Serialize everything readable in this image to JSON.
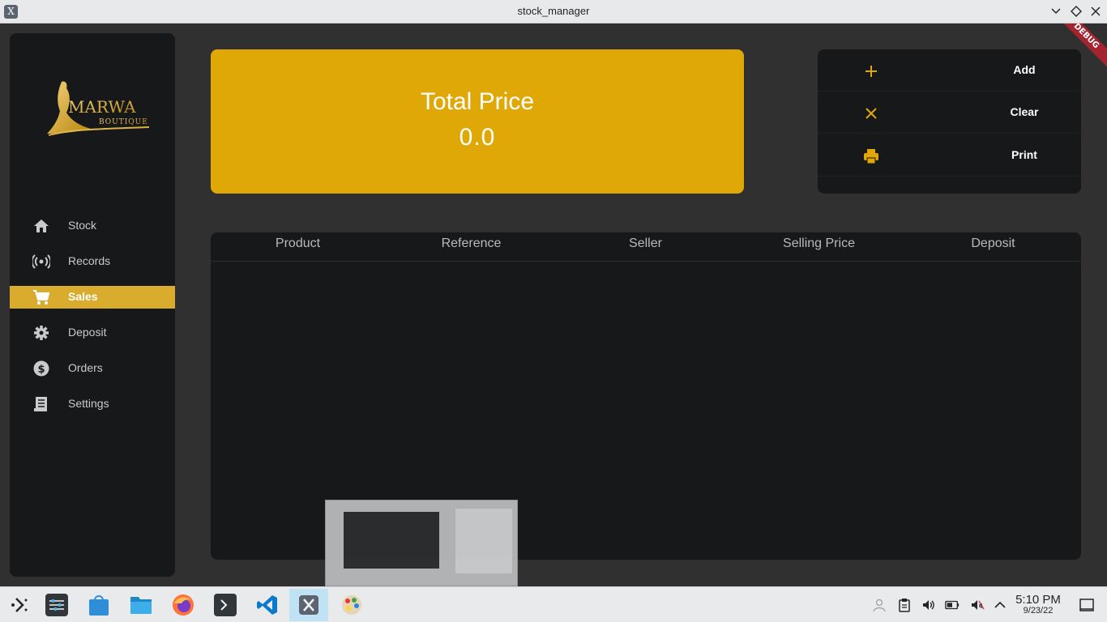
{
  "window": {
    "title": "stock_manager"
  },
  "debug_banner": "DEBUG",
  "logo": {
    "name": "MARWA",
    "tagline": "BOUTIQUE"
  },
  "sidebar": {
    "items": [
      {
        "label": "Stock",
        "icon": "home-icon",
        "active": false
      },
      {
        "label": "Records",
        "icon": "broadcast-icon",
        "active": false
      },
      {
        "label": "Sales",
        "icon": "cart-icon",
        "active": true
      },
      {
        "label": "Deposit",
        "icon": "gear-icon",
        "active": false
      },
      {
        "label": "Orders",
        "icon": "dollar-icon",
        "active": false
      },
      {
        "label": "Settings",
        "icon": "receipt-icon",
        "active": false
      }
    ]
  },
  "total": {
    "label": "Total Price",
    "value": "0.0"
  },
  "actions": [
    {
      "label": "Add",
      "icon": "plus-icon"
    },
    {
      "label": "Clear",
      "icon": "close-icon"
    },
    {
      "label": "Print",
      "icon": "printer-icon"
    }
  ],
  "table": {
    "columns": [
      "Product",
      "Reference",
      "Seller",
      "Selling Price",
      "Deposit"
    ],
    "rows": []
  },
  "taskbar": {
    "apps": [
      "launcher-icon",
      "settings-icon",
      "discover-icon",
      "files-icon",
      "firefox-icon",
      "terminal-icon",
      "vscode-icon",
      "stock-manager-icon",
      "paint-icon"
    ],
    "clock": {
      "time": "5:10 PM",
      "date": "9/23/22"
    }
  },
  "colors": {
    "accent": "#e0a807",
    "sidebar_active": "#d9ac2e",
    "panel": "#161819",
    "background": "#303030"
  }
}
